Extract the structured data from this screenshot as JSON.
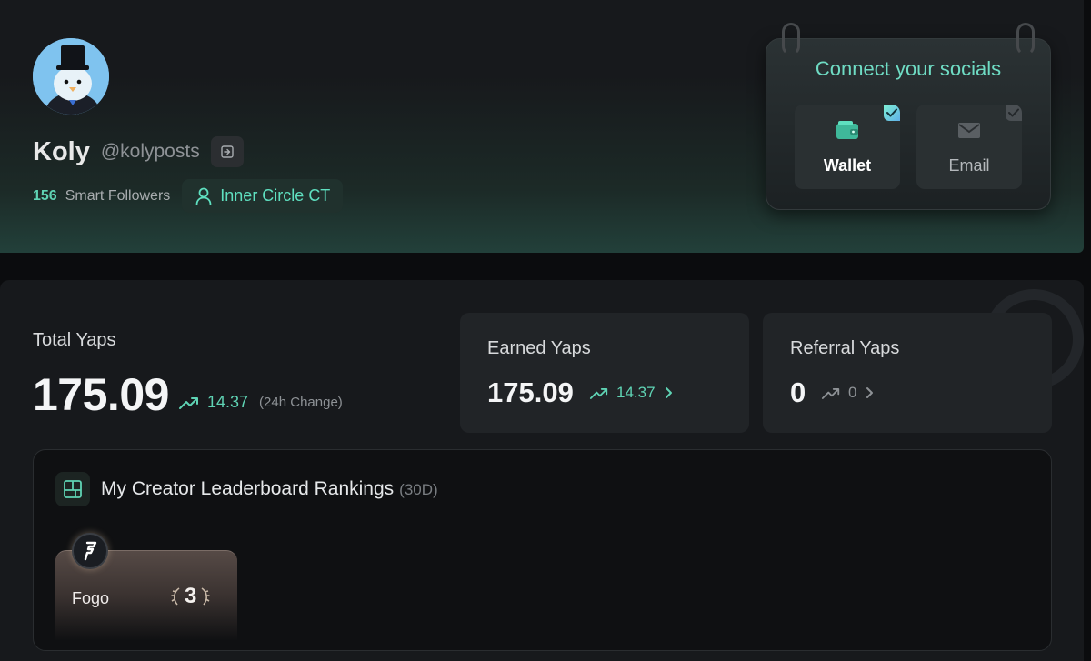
{
  "profile": {
    "name": "Koly",
    "handle": "@kolyposts",
    "followers_count": "156",
    "followers_label": "Smart Followers",
    "badge_label": "Inner Circle CT"
  },
  "socials": {
    "title": "Connect your socials",
    "tiles": [
      {
        "label": "Wallet",
        "icon": "wallet-icon",
        "connected": true
      },
      {
        "label": "Email",
        "icon": "mail-icon",
        "connected": false
      }
    ]
  },
  "stats": {
    "total": {
      "label": "Total Yaps",
      "value": "175.09",
      "change": "14.37",
      "change_note": "(24h Change)"
    },
    "earned": {
      "label": "Earned Yaps",
      "value": "175.09",
      "change": "14.37"
    },
    "referral": {
      "label": "Referral Yaps",
      "value": "0",
      "change": "0"
    }
  },
  "rankings": {
    "title": "My Creator Leaderboard Rankings",
    "period": "(30D)",
    "projects": [
      {
        "name": "Fogo",
        "rank": "3"
      }
    ]
  },
  "colors": {
    "accent": "#5fd3b4",
    "background": "#0b0c0e",
    "card": "#17191c"
  }
}
